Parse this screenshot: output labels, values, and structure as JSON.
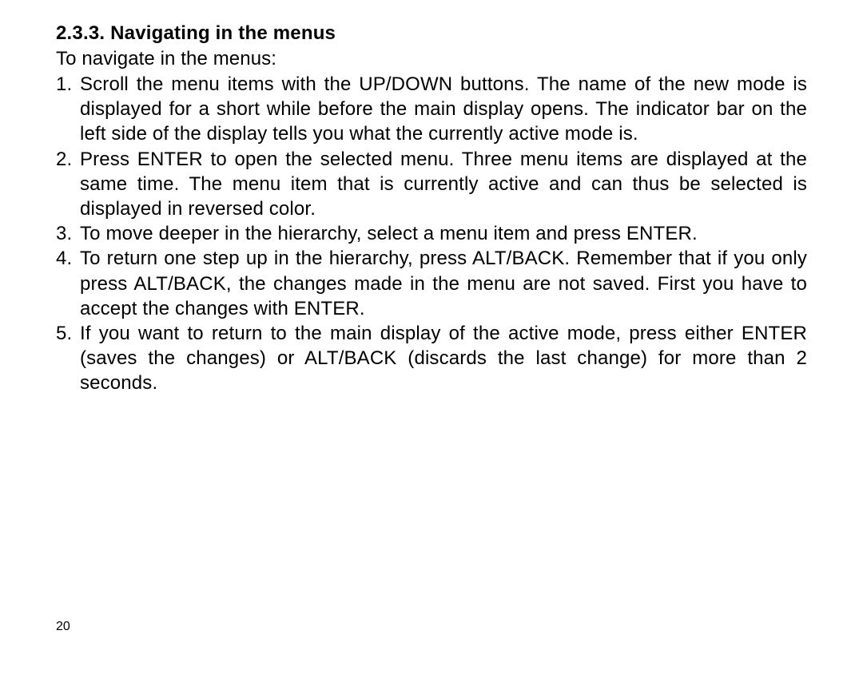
{
  "section": {
    "number": "2.3.3.",
    "title": "Navigating in the menus"
  },
  "intro": "To navigate in the menus:",
  "items": [
    "Scroll the menu items with the UP/DOWN buttons. The name of the new mode is displayed for a short while before the main display opens. The indicator bar on the left side of the display tells you what the currently active mode is.",
    "Press ENTER to open the selected menu. Three menu items are displayed at the same time. The menu item that is currently active and can thus be selected is displayed in reversed color.",
    "To move deeper in the hierarchy, select a menu item and press ENTER.",
    "To return one step up in the hierarchy, press ALT/BACK. Remember that if you only press ALT/BACK, the changes made in the menu are not saved. First you have to accept the changes with ENTER.",
    "If you want to return to the main display of the active mode, press either ENTER (saves the changes) or ALT/BACK (discards the last change) for more than 2 seconds."
  ],
  "page_number": "20"
}
